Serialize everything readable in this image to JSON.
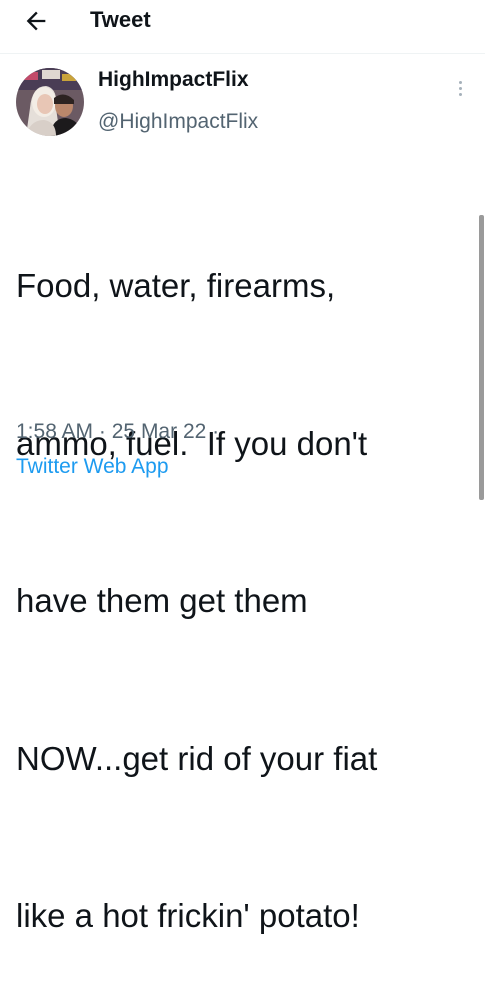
{
  "header": {
    "title": "Tweet",
    "back_icon": "arrow-left-icon"
  },
  "tweet": {
    "display_name": "HighImpactFlix",
    "handle": "@HighImpactFlix",
    "text_lines": [
      "Food, water, firearms,",
      "ammo, fuel.  If you don't",
      "have them get them",
      "NOW...get rid of your fiat",
      "like a hot frickin' potato!"
    ],
    "time": "1:58 AM",
    "separator": "·",
    "date": "25 Mar 22",
    "separator2": "·",
    "source": "Twitter Web App",
    "more_icon": "more-vertical-icon"
  },
  "colors": {
    "text": "#0f1419",
    "secondary": "#536471",
    "link": "#1d9bf0"
  }
}
